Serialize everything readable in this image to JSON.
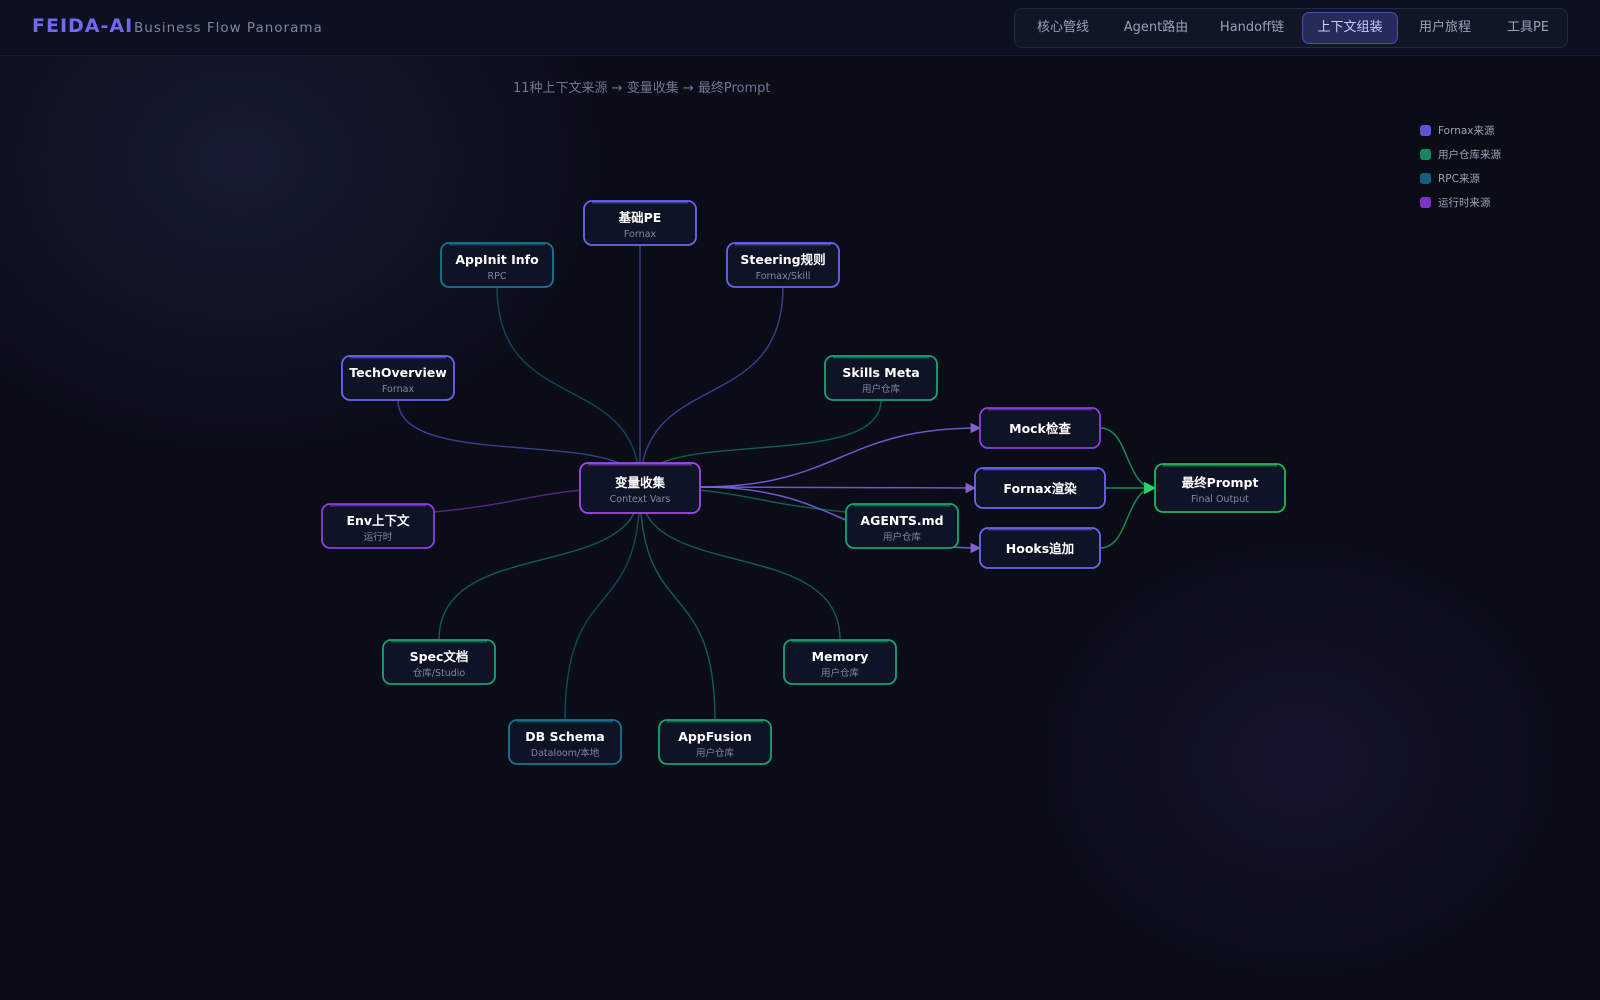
{
  "header": {
    "brand": "FEIDA-AI",
    "subtitle": "Business Flow Panorama",
    "tabs": [
      {
        "label": "核心管线",
        "active": false
      },
      {
        "label": "Agent路由",
        "active": false
      },
      {
        "label": "Handoff链",
        "active": false
      },
      {
        "label": "上下文组装",
        "active": true
      },
      {
        "label": "用户旅程",
        "active": false
      },
      {
        "label": "工具PE",
        "active": false
      }
    ]
  },
  "caption": "11种上下文来源 → 变量收集 → 最终Prompt",
  "legend": [
    {
      "label": "Fornax来源",
      "color": "#5b54d6"
    },
    {
      "label": "用户仓库来源",
      "color": "#13875f"
    },
    {
      "label": "RPC来源",
      "color": "#14607a"
    },
    {
      "label": "运行时来源",
      "color": "#7d33c8"
    }
  ],
  "colors": {
    "fornax": "#6b66f2",
    "repo": "#18a374",
    "rpc": "#1a7690",
    "runtime": "#8f3ee0",
    "output": "#1fb85e",
    "hub": "#a347f0",
    "nodeFill": "#0f1326"
  },
  "diagram": {
    "hub": {
      "title": "变量收集",
      "sub": "Context Vars",
      "kind": "hub"
    },
    "sources": [
      {
        "id": "jichu",
        "title": "基础PE",
        "sub": "Fornax",
        "kind": "fornax"
      },
      {
        "id": "appinit",
        "title": "AppInit Info",
        "sub": "RPC",
        "kind": "rpc"
      },
      {
        "id": "steering",
        "title": "Steering规则",
        "sub": "Fornax/Skill",
        "kind": "fornax"
      },
      {
        "id": "techoverview",
        "title": "TechOverview",
        "sub": "Fornax",
        "kind": "fornax"
      },
      {
        "id": "skills",
        "title": "Skills Meta",
        "sub": "用户仓库",
        "kind": "repo"
      },
      {
        "id": "env",
        "title": "Env上下文",
        "sub": "运行时",
        "kind": "runtime"
      },
      {
        "id": "agents",
        "title": "AGENTS.md",
        "sub": "用户仓库",
        "kind": "repo"
      },
      {
        "id": "spec",
        "title": "Spec文档",
        "sub": "仓库/Studio",
        "kind": "repo"
      },
      {
        "id": "memory",
        "title": "Memory",
        "sub": "用户仓库",
        "kind": "repo"
      },
      {
        "id": "dbschema",
        "title": "DB Schema",
        "sub": "Dataloom/本地",
        "kind": "rpc"
      },
      {
        "id": "appfusion",
        "title": "AppFusion",
        "sub": "用户仓库",
        "kind": "repo"
      }
    ],
    "steps": [
      {
        "id": "mock",
        "title": "Mock检查",
        "kind": "runtime"
      },
      {
        "id": "render",
        "title": "Fornax渲染",
        "kind": "fornax"
      },
      {
        "id": "hooks",
        "title": "Hooks追加",
        "kind": "fornax"
      }
    ],
    "output": {
      "title": "最终Prompt",
      "sub": "Final Output",
      "kind": "output"
    }
  }
}
